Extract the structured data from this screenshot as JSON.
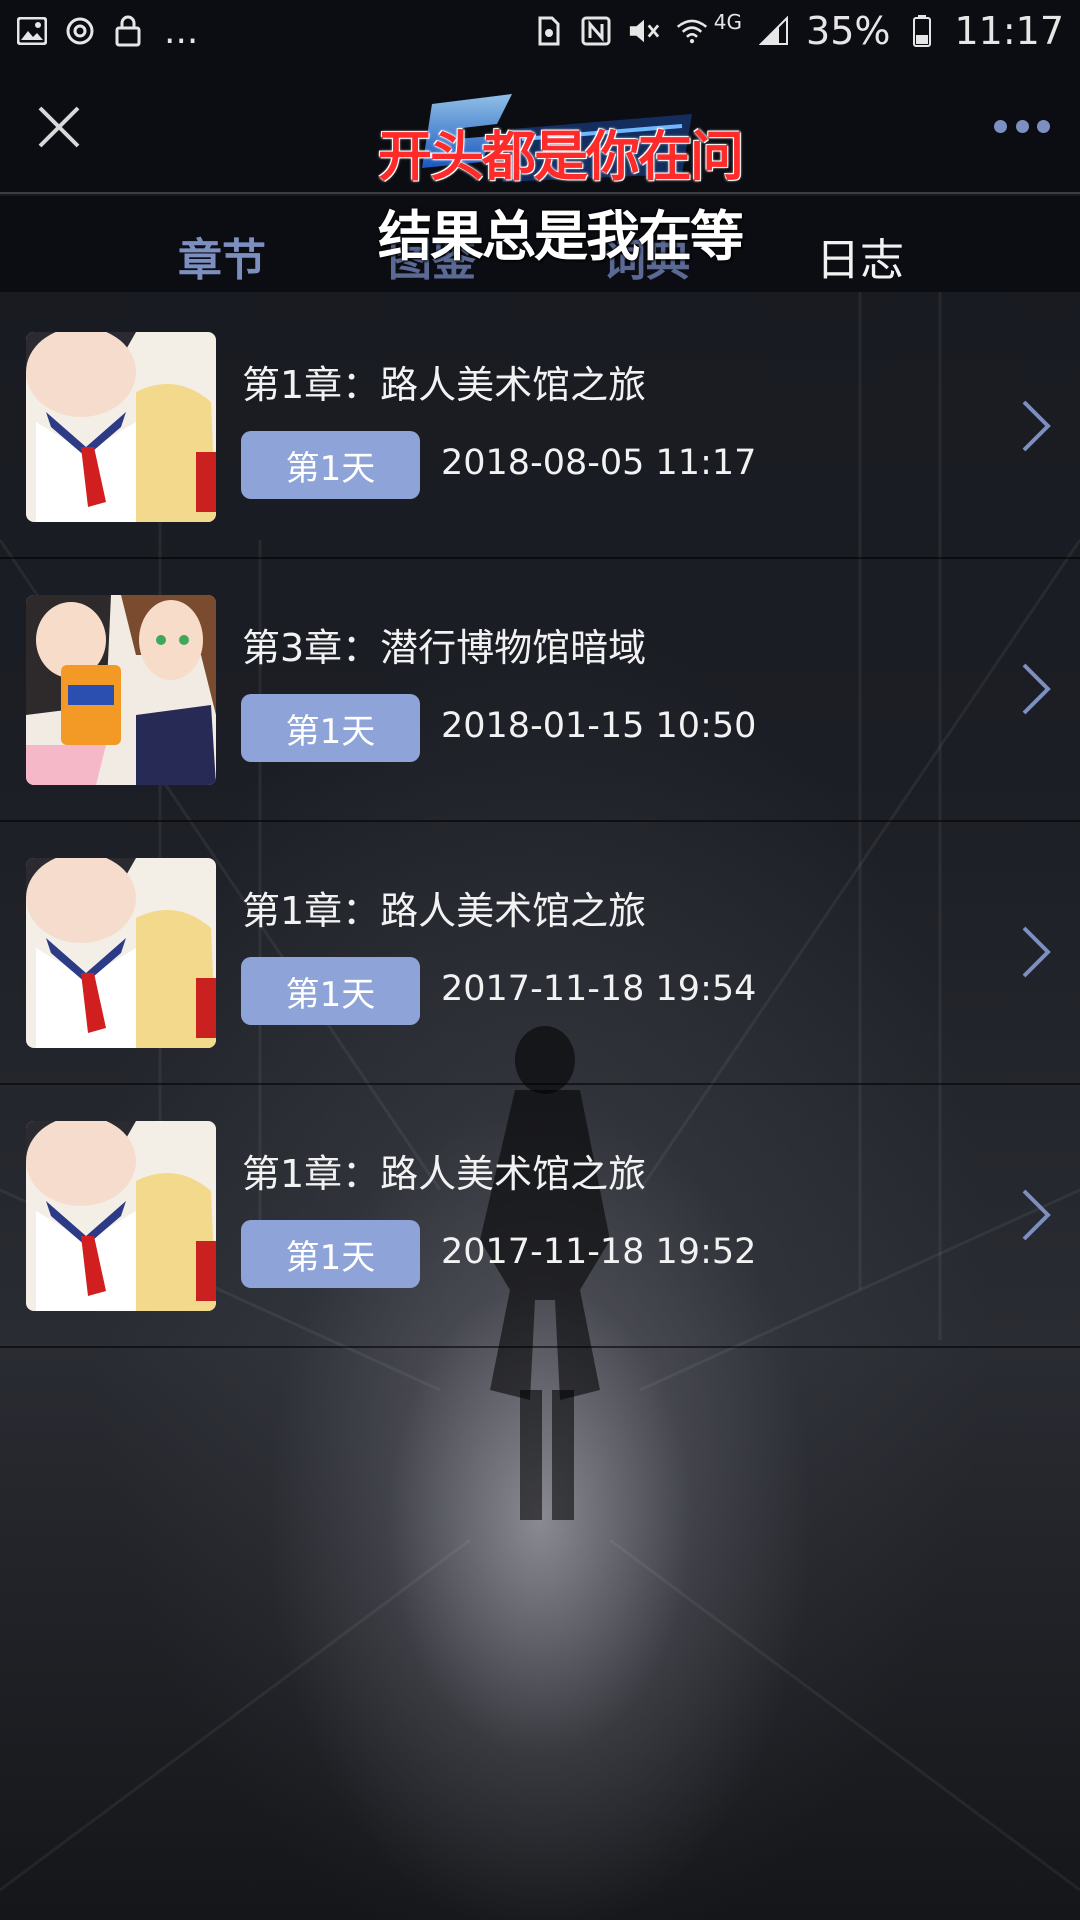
{
  "status_bar": {
    "battery_percent": "35%",
    "time": "11:17",
    "network": "4G",
    "left_overflow": "...",
    "left_icons": [
      "image-icon",
      "sync-icon",
      "lock-icon"
    ],
    "right_icons": [
      "nfc-tag-icon",
      "nfc-icon",
      "mute-icon",
      "wifi-icon",
      "signal-icon",
      "battery-icon"
    ]
  },
  "header": {
    "overlay_line1": "开头都是你在问",
    "overlay_line2": "结果总是我在等",
    "close_icon": "close-icon",
    "more_icon": "more-dots-icon"
  },
  "tabs": [
    {
      "label": "章节",
      "active": true
    },
    {
      "label": "图鉴",
      "active": false
    },
    {
      "label": "词典",
      "active": false
    },
    {
      "label": "日志",
      "active": false
    }
  ],
  "entries": [
    {
      "title": "第1章：路人美术馆之旅",
      "day": "第1天",
      "datetime": "2018-08-05 11:17"
    },
    {
      "title": "第3章：潜行博物馆暗域",
      "day": "第1天",
      "datetime": "2018-01-15 10:50"
    },
    {
      "title": "第1章：路人美术馆之旅",
      "day": "第1天",
      "datetime": "2017-11-18 19:54"
    },
    {
      "title": "第1章：路人美术馆之旅",
      "day": "第1天",
      "datetime": "2017-11-18 19:52"
    }
  ],
  "colors": {
    "accent": "#7d8fc1",
    "badge": "#8ea3d8",
    "overlay_red": "#ff2a2a",
    "background": "#0c0d12"
  }
}
